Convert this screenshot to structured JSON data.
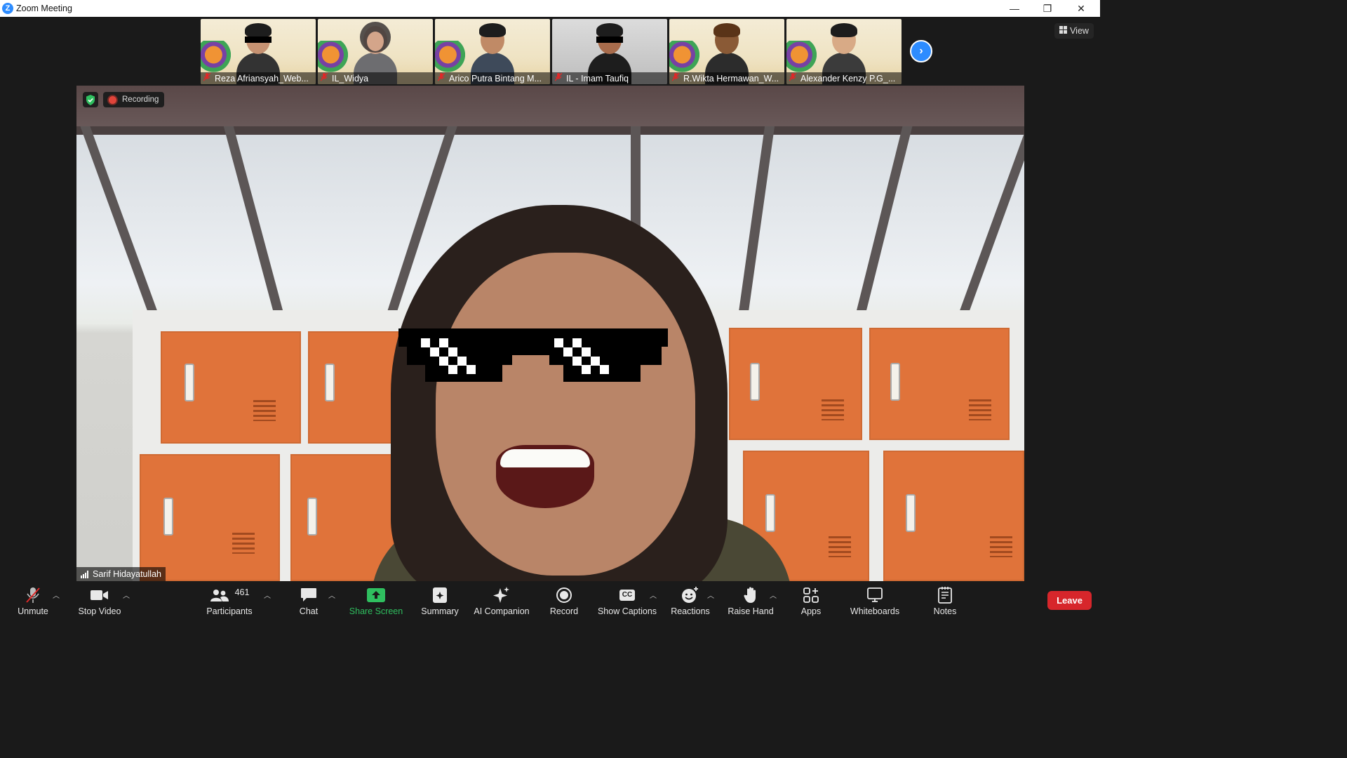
{
  "window": {
    "title": "Zoom Meeting",
    "app_icon_letter": "Z",
    "minimize_glyph": "—",
    "restore_glyph": "❐",
    "close_glyph": "✕"
  },
  "gallery": {
    "participants": [
      {
        "name": "Reza Afriansyah_Web...",
        "muted": true
      },
      {
        "name": "IL_Widya",
        "muted": true
      },
      {
        "name": "Arico Putra Bintang M...",
        "muted": true
      },
      {
        "name": "IL - Imam Taufiq",
        "muted": true
      },
      {
        "name": "R.Wikta Hermawan_W...",
        "muted": true
      },
      {
        "name": "Alexander Kenzy P.G_...",
        "muted": true
      }
    ],
    "next_glyph": "›",
    "view_label": "View"
  },
  "main_video": {
    "speaker_name": "Sarif Hidayatullah",
    "recording_label": "Recording"
  },
  "toolbar": {
    "unmute_label": "Unmute",
    "stop_video_label": "Stop Video",
    "participants_label": "Participants",
    "participants_count": "461",
    "chat_label": "Chat",
    "share_screen_label": "Share Screen",
    "summary_label": "Summary",
    "ai_companion_label": "AI Companion",
    "record_label": "Record",
    "show_captions_label": "Show Captions",
    "captions_icon_text": "CC",
    "reactions_label": "Reactions",
    "raise_hand_label": "Raise Hand",
    "apps_label": "Apps",
    "whiteboards_label": "Whiteboards",
    "notes_label": "Notes",
    "leave_label": "Leave"
  },
  "colors": {
    "accent_blue": "#2d8cff",
    "leave_red": "#d7262b",
    "share_green": "#2fbf5f",
    "muted_red": "#e02828"
  }
}
